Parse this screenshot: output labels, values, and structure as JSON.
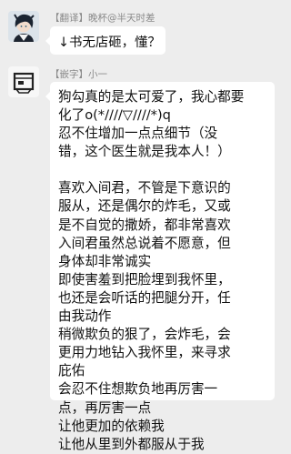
{
  "messages": [
    {
      "sender": "【翻译】晚杯@半天时差",
      "text": "↓书无店砸，懂？"
    },
    {
      "sender": "【嵌字】小一",
      "paragraphs": [
        [
          "狗勾真的是太可爱了，我心都要",
          "化了o(*////▽////*)q",
          "忍不住增加一点点细节（没",
          "错，这个医生就是我本人！）"
        ],
        [
          "喜欢入间君，不管是下意识的",
          "服从，还是偶尔的炸毛，又或",
          "是不自觉的撒娇，都非常喜欢",
          "入间君虽然总说着不愿意，但",
          "身体却非常诚实",
          "即使害羞到把脸埋到我怀里，",
          "也还是会听话的把腿分开，任",
          "由我动作",
          "稍微欺负的狠了，会炸毛，会",
          "更用力地钻入我怀里，来寻求",
          "庇佑",
          "会忍不住想欺负地再厉害一",
          "点，再厉害一点",
          "让他更加的依赖我",
          "让他从里到外都服从于我"
        ]
      ]
    }
  ]
}
